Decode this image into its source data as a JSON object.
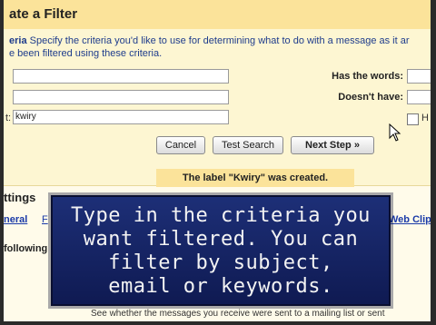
{
  "header": {
    "title": "ate a Filter"
  },
  "criteria": {
    "label": "eria",
    "text": "Specify the criteria you'd like to use for determining what to do with a message as it ar",
    "text2": "e been filtered using these criteria."
  },
  "fields": {
    "from_label": "",
    "to_label": "",
    "subject_label": "t:",
    "from_value": "",
    "to_value": "",
    "subject_value": "kwiry"
  },
  "right_fields": {
    "has_words_label": "Has the words:",
    "doesnt_have_label": "Doesn't have:",
    "has_attachment_label": "H"
  },
  "buttons": {
    "cancel": "Cancel",
    "test_search": "Test Search",
    "next_step": "Next Step »"
  },
  "notice": {
    "text": "The label \"Kwiry\" was created."
  },
  "settings": {
    "title": "ttings",
    "tab_general": "neral",
    "tab_filters": "F",
    "tab_web_clips": "Web Clip",
    "following": "following"
  },
  "bottom_line": "See whether the messages you receive were sent to a mailing list or sent",
  "caption": {
    "lines": [
      "Type in the criteria you",
      "want filtered. You can",
      "filter by subject,",
      "email or keywords."
    ]
  },
  "colors": {
    "header_bg": "#fbe39a",
    "panel_bg": "#fdf6d2",
    "caption_bg": "#1d2f77",
    "link": "#1a3aa8"
  }
}
